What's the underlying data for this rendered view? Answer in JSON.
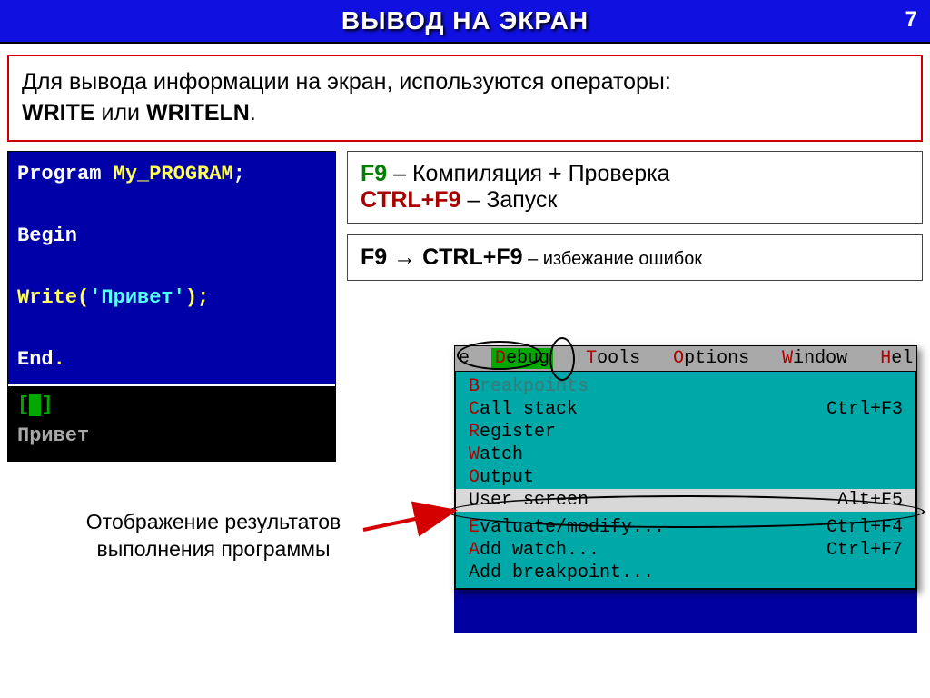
{
  "header": {
    "title": "ВЫВОД НА ЭКРАН",
    "page_number": "7"
  },
  "info": {
    "text_before": "Для вывода информации на экран, используются операторы: ",
    "kw1": "WRITE",
    "or": " или ",
    "kw2": "WRITELN",
    "dot": "."
  },
  "code": {
    "l1a": "Program ",
    "l1b": "My_PROGRAM",
    "l1c": ";",
    "l2": "Begin",
    "l3a": "  Write(",
    "l3b": "'Привет'",
    "l3c": ");",
    "l4a": "End",
    "l4b": ".",
    "out_brackets": "[ ]",
    "out_text": "Привет"
  },
  "keys": {
    "f9": "F9",
    "f9_desc": " – Компиляция + Проверка",
    "ctrlf9": "CTRL+F9",
    "ctrlf9_desc": " – Запуск"
  },
  "seq": {
    "a": "F9",
    "arrow": " → ",
    "b": "CTRL+F9",
    "desc": " – избежание ошибок"
  },
  "caption": {
    "l1": "Отображение результатов",
    "l2": "выполнения программы"
  },
  "menu": {
    "bar_prefix": "e  ",
    "debug": "Debug",
    "items_bar": [
      "Tools",
      "Options",
      "Window",
      "Hel"
    ],
    "rows": [
      {
        "label": "Breakpoints",
        "shortcut": "",
        "disabled": true,
        "hot": "B"
      },
      {
        "label": "Call stack",
        "shortcut": "Ctrl+F3",
        "hot": "C"
      },
      {
        "label": "Register",
        "shortcut": "",
        "hot": "R"
      },
      {
        "label": "Watch",
        "shortcut": "",
        "hot": "W"
      },
      {
        "label": "Output",
        "shortcut": "",
        "hot": "O"
      },
      {
        "label": "User screen",
        "shortcut": "Alt+F5",
        "highlight": true
      },
      {
        "sep": true
      },
      {
        "label": "Evaluate/modify...",
        "shortcut": "Ctrl+F4",
        "hot": "E"
      },
      {
        "label": "Add watch...",
        "shortcut": "Ctrl+F7",
        "hot": "A"
      },
      {
        "label": "Add breakpoint...",
        "shortcut": ""
      }
    ]
  }
}
